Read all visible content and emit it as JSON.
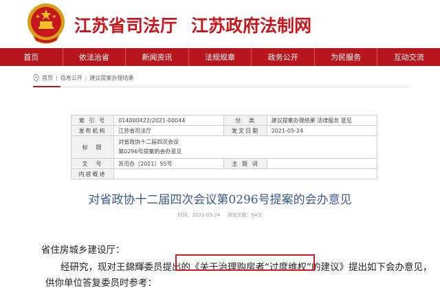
{
  "header": {
    "site_name_1": "江苏省司法厅",
    "site_name_2": "江苏政府法制网"
  },
  "nav": {
    "items": [
      "首页",
      "依法治省",
      "新闻资讯",
      "法规规章",
      "政务公开",
      "为民服务",
      "互动交流"
    ]
  },
  "breadcrumb": {
    "items": [
      "首页",
      "信息公开",
      "建议提案办理结果"
    ]
  },
  "info": {
    "index_key": "索 引 号",
    "index_val": "014000422/2021-00044",
    "category_key": "分　类",
    "category_val": "建议提案办理结果 法律服务 意见",
    "publisher_key": "发布机构",
    "publisher_val": "江苏省司法厅",
    "date_key": "发文日期",
    "date_val": "2021-05-24",
    "title_key": "标　题",
    "title_val_1": "对省政协十二届四次会议",
    "title_val_2": "第0296号提案的会办意见",
    "docno_key": "文　号",
    "docno_val": "苏司办〔2021〕55号",
    "topic_key": "主 题 词",
    "topic_val": "",
    "summary_key": "内容概述",
    "summary_val": ""
  },
  "article": {
    "title": "对省政协十二届四次会议第0296号提案的会办意见",
    "meta_time": "时间：2021-05-24",
    "meta_views": "浏览次数：94次",
    "p1": "省住房城乡建设厅：",
    "p2": "经研究，现对王錦輝委员提出的《关于治理购房者“过度维权”的建议》提出如下会办意见，",
    "p3": "供你单位答复委员时参考："
  },
  "colors": {
    "brand_red": "#b7161c",
    "title_blue": "#3b5a8a",
    "highlight_red": "#d8191f"
  }
}
